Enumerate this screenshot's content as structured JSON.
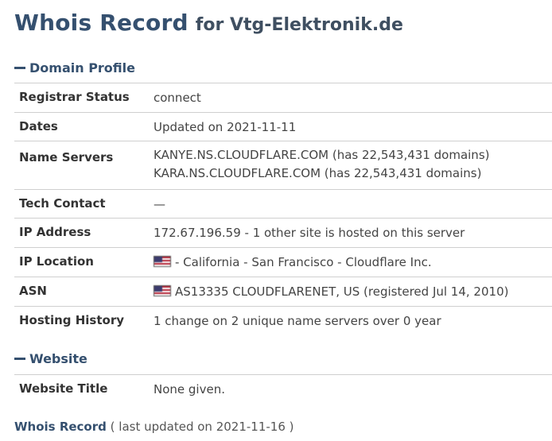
{
  "title": {
    "main": "Whois Record",
    "suffix": "for Vtg-Elektronik.de"
  },
  "sections": {
    "domain_profile": "Domain Profile",
    "website": "Website"
  },
  "rows": {
    "registrar_status": {
      "key": "Registrar Status",
      "value": "connect"
    },
    "dates": {
      "key": "Dates",
      "value": "Updated on 2021-11-11"
    },
    "name_servers": {
      "key": "Name Servers",
      "line1": "KANYE.NS.CLOUDFLARE.COM (has 22,543,431 domains)",
      "line2": "KARA.NS.CLOUDFLARE.COM (has 22,543,431 domains)"
    },
    "tech_contact": {
      "key": "Tech Contact",
      "value": "—"
    },
    "ip_address": {
      "key": "IP Address",
      "value": "172.67.196.59 - 1 other site is hosted on this server"
    },
    "ip_location": {
      "key": "IP Location",
      "value": "- California - San Francisco - Cloudflare Inc.",
      "icon": "us-flag-icon"
    },
    "asn": {
      "key": "ASN",
      "value": "AS13335 CLOUDFLARENET, US (registered Jul 14, 2010)",
      "icon": "us-flag-icon"
    },
    "hosting_history": {
      "key": "Hosting History",
      "value": "1 change on 2 unique name servers over 0 year"
    },
    "website_title": {
      "key": "Website Title",
      "value": "None given."
    }
  },
  "footer": {
    "link": "Whois Record",
    "meta": "( last updated on 2021-11-16 )"
  }
}
